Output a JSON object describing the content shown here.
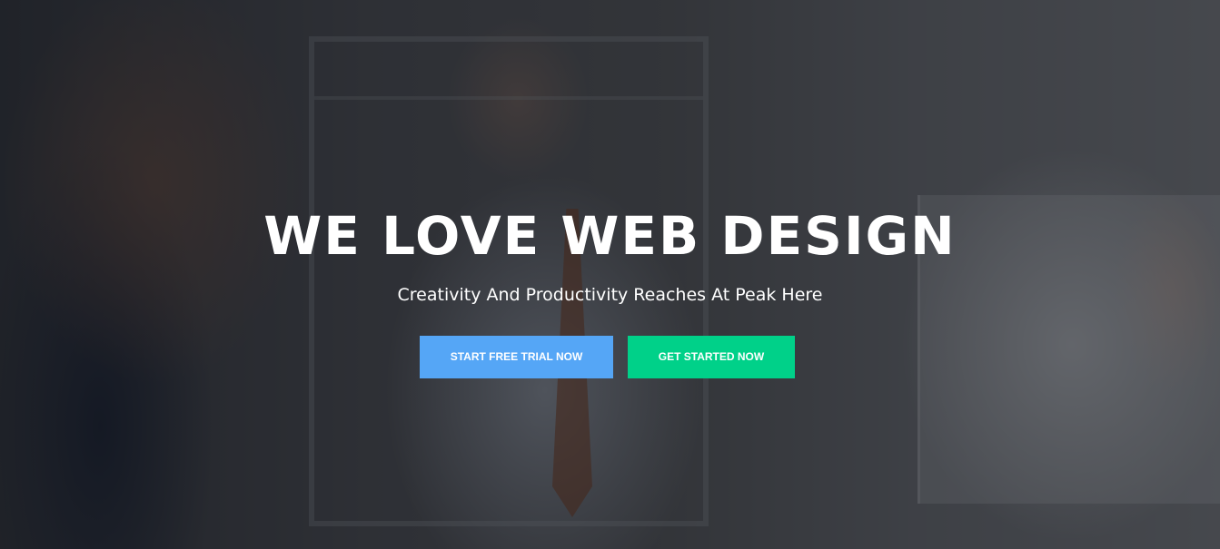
{
  "hero": {
    "title": "WE LOVE WEB DESIGN",
    "subtitle": "Creativity And Productivity Reaches At Peak Here",
    "buttons": {
      "primary_label": "START FREE TRIAL NOW",
      "secondary_label": "GET STARTED NOW"
    },
    "colors": {
      "primary_button": "#55a6f6",
      "secondary_button": "#00d189",
      "text": "#ffffff"
    }
  }
}
